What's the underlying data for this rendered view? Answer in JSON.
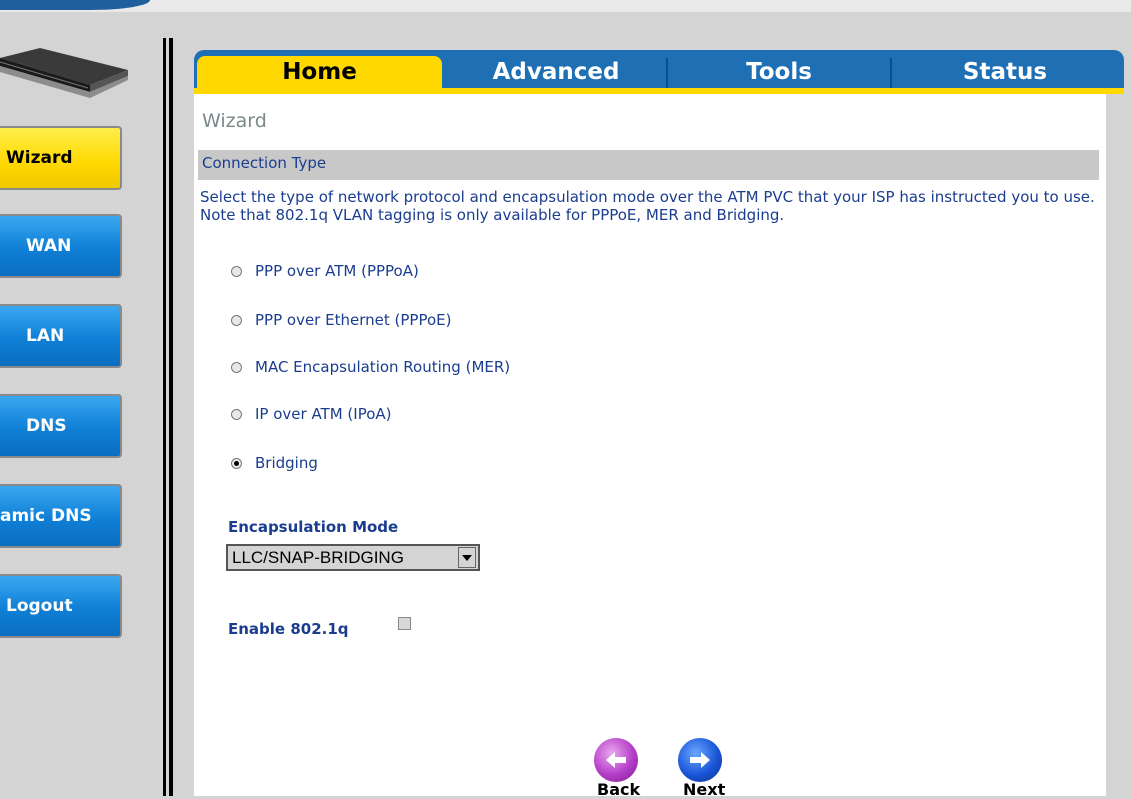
{
  "tabs": [
    {
      "label": "Home",
      "active": true
    },
    {
      "label": "Advanced"
    },
    {
      "label": "Tools"
    },
    {
      "label": "Status"
    }
  ],
  "sidebar": {
    "items": [
      {
        "label": "Wizard",
        "active": true
      },
      {
        "label": "WAN"
      },
      {
        "label": "LAN"
      },
      {
        "label": "DNS"
      },
      {
        "label": "amic DNS"
      },
      {
        "label": "Logout"
      }
    ]
  },
  "page": {
    "title": "Wizard",
    "section_title": "Connection Type",
    "description": "Select the type of network protocol and encapsulation mode over the ATM PVC that your ISP has instructed you to use. Note that 802.1q VLAN tagging is only available for PPPoE, MER and Bridging."
  },
  "options": [
    {
      "label": "PPP over ATM (PPPoA)",
      "checked": false
    },
    {
      "label": "PPP over Ethernet (PPPoE)",
      "checked": false
    },
    {
      "label": "MAC Encapsulation Routing (MER)",
      "checked": false
    },
    {
      "label": "IP over ATM (IPoA)",
      "checked": false
    },
    {
      "label": "Bridging",
      "checked": true
    }
  ],
  "encapsulation": {
    "label": "Encapsulation Mode",
    "value": "LLC/SNAP-BRIDGING"
  },
  "vlan": {
    "label": "Enable 802.1q",
    "checked": false
  },
  "nav": {
    "back_label": "Back",
    "next_label": "Next"
  },
  "colors": {
    "tab_blue": "#1f6fb5",
    "tab_yellow": "#ffd800",
    "text_blue": "#1b3d8f",
    "sidebar_blue": "#0f7fd6"
  }
}
